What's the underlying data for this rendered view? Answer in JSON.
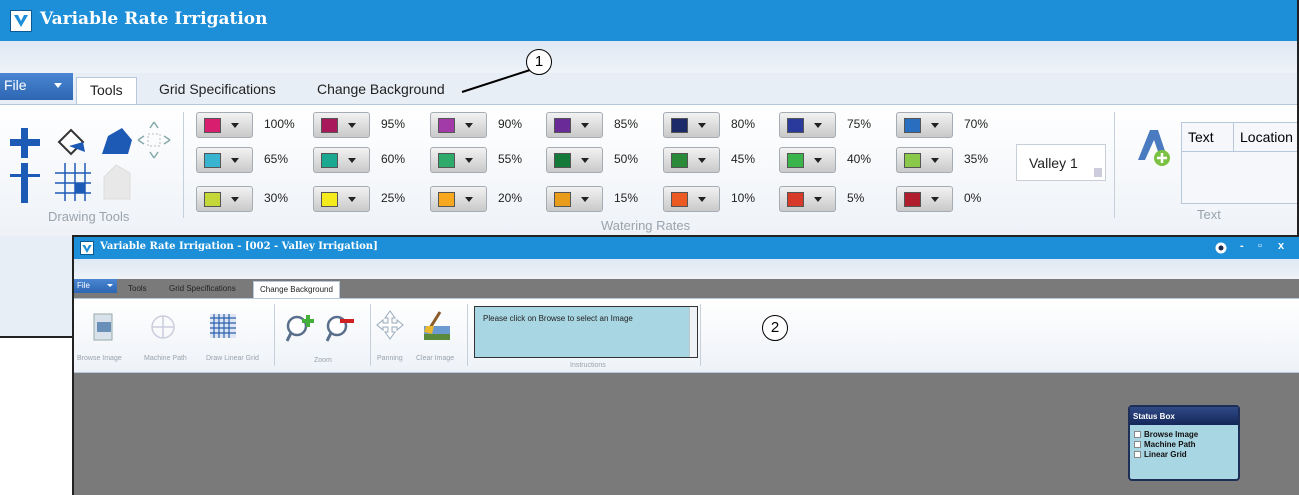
{
  "main_window": {
    "title": "Variable Rate Irrigation",
    "file_menu": "File",
    "tabs": [
      "Tools",
      "Grid Specifications",
      "Change Background"
    ],
    "active_tab": "Tools",
    "drawing_tools_label": "Drawing Tools",
    "watering_rates_label": "Watering Rates",
    "watering_rates": [
      {
        "percent": "100%",
        "color": "#d81e6e"
      },
      {
        "percent": "95%",
        "color": "#a8185a"
      },
      {
        "percent": "90%",
        "color": "#a23aa8"
      },
      {
        "percent": "85%",
        "color": "#6a2a98"
      },
      {
        "percent": "80%",
        "color": "#1c2a6a"
      },
      {
        "percent": "75%",
        "color": "#2a3a9c"
      },
      {
        "percent": "70%",
        "color": "#2a6ec0"
      },
      {
        "percent": "65%",
        "color": "#38b4d0"
      },
      {
        "percent": "60%",
        "color": "#1aa890"
      },
      {
        "percent": "55%",
        "color": "#2eaa6a"
      },
      {
        "percent": "50%",
        "color": "#147a3a"
      },
      {
        "percent": "45%",
        "color": "#2a8a3a"
      },
      {
        "percent": "40%",
        "color": "#3cb44c"
      },
      {
        "percent": "35%",
        "color": "#8ac84a"
      },
      {
        "percent": "30%",
        "color": "#c4d638"
      },
      {
        "percent": "25%",
        "color": "#f4ea1c"
      },
      {
        "percent": "20%",
        "color": "#f7a81e"
      },
      {
        "percent": "15%",
        "color": "#e89c1a"
      },
      {
        "percent": "10%",
        "color": "#ea5a22"
      },
      {
        "percent": "5%",
        "color": "#d83a2a"
      },
      {
        "percent": "0%",
        "color": "#b01e2e"
      }
    ],
    "valley_selector": "Valley 1",
    "text_table_headers": [
      "Text",
      "Location"
    ],
    "text_group_label": "Text"
  },
  "callouts": [
    "1",
    "2"
  ],
  "second_window": {
    "title": "Variable Rate Irrigation - [002 - Valley Irrigation]",
    "file_menu": "File",
    "tabs": [
      "Tools",
      "Grid Specifications",
      "Change Background"
    ],
    "active_tab": "Change Background",
    "tools": [
      "Browse Image",
      "Machine Path",
      "Draw Linear Grid",
      "Zoom",
      "Panning",
      "Clear Image",
      "Instructions"
    ],
    "instructions_text": "Please click on Browse to select an Image",
    "status_box": {
      "title": "Status Box",
      "items": [
        "Browse Image",
        "Machine Path",
        "Linear Grid"
      ]
    }
  },
  "colors": {
    "title_bar": "#1c8fd8",
    "canvas_gray": "#7a7a7a",
    "instructions_bg": "#a9d6e3"
  }
}
